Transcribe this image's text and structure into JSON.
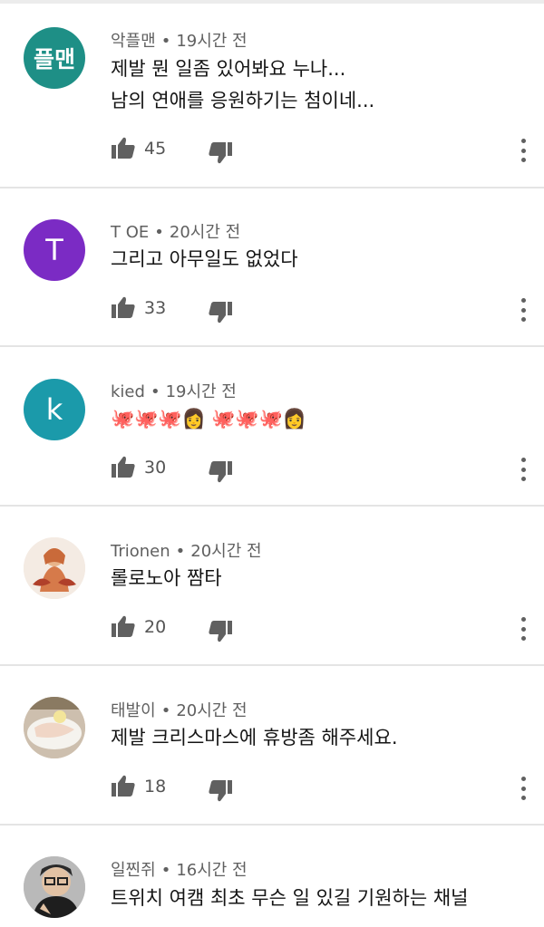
{
  "comments": [
    {
      "avatar_text": "플맨",
      "avatar_color": "#1e8f86",
      "author": "악플맨",
      "time": "19시간 전",
      "lines": [
        "제발 뭔 일좀 있어봐요 누나...",
        "남의 연애를 응원하기는 첨이네..."
      ],
      "likes": "45"
    },
    {
      "avatar_text": "T",
      "avatar_color": "#7b2bc4",
      "author": "T OE",
      "time": "20시간 전",
      "lines": [
        "그리고 아무일도 없었다"
      ],
      "likes": "33"
    },
    {
      "avatar_text": "k",
      "avatar_color": "#1b9aaa",
      "author": "kied",
      "time": "19시간 전",
      "lines": [
        "🐙🐙🐙👩 🐙🐙🐙👩"
      ],
      "likes": "30"
    },
    {
      "avatar_text": "",
      "avatar_color": "#f1e6dc",
      "author": "Trionen",
      "time": "20시간 전",
      "lines": [
        "롤로노아 짬타"
      ],
      "likes": "20"
    },
    {
      "avatar_text": "",
      "avatar_color": "#d9c9b2",
      "author": "태발이",
      "time": "20시간 전",
      "lines": [
        "제발 크리스마스에 휴방좀 해주세요."
      ],
      "likes": "18"
    },
    {
      "avatar_text": "",
      "avatar_color": "#c8c8c8",
      "author": "일찐쥐",
      "time": "16시간 전",
      "lines": [
        "트위치 여캠 최초 무슨 일 있길 기원하는 채널"
      ],
      "likes": ""
    }
  ],
  "icons": {
    "like": "thumbs-up-icon",
    "dislike": "thumbs-down-icon",
    "more": "more-vert-icon"
  },
  "separator": "•"
}
